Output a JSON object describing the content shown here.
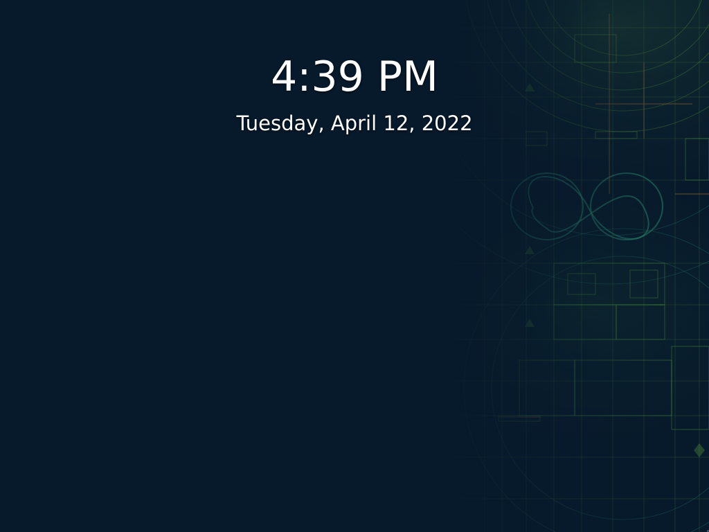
{
  "lock_screen": {
    "time": "4:39 PM",
    "date": "Tuesday, April 12, 2022",
    "wallpaper": {
      "background_color": "#071a2b",
      "line_color_green": "#5ea13a",
      "line_color_teal": "#2f7f6b",
      "line_color_orange": "#8a5c2b"
    }
  }
}
